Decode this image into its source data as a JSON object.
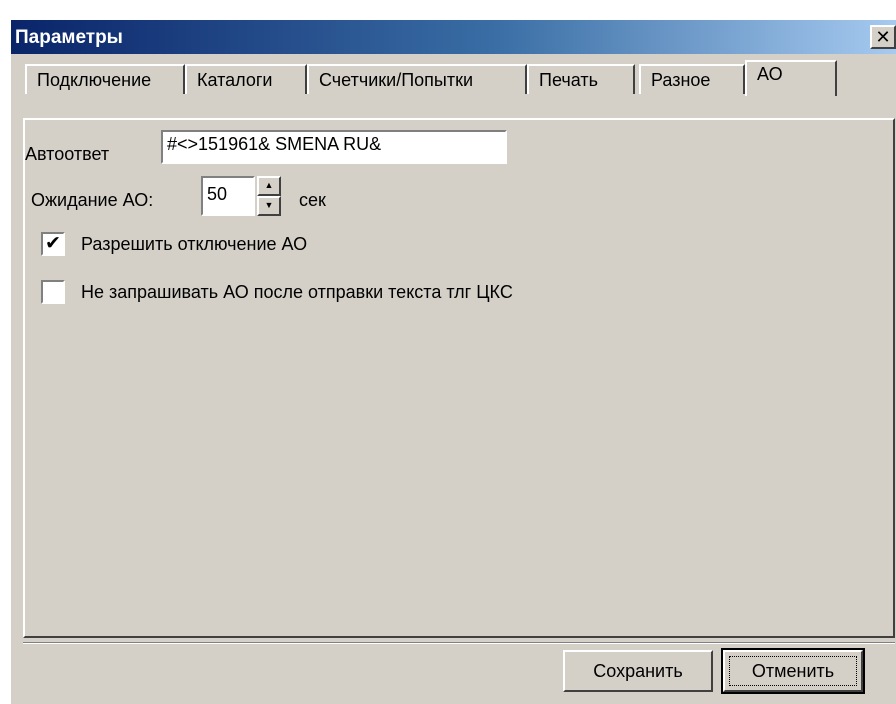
{
  "window": {
    "title": "Параметры",
    "close_glyph": "✕",
    "close_icon": "close-icon"
  },
  "tabs": [
    {
      "label": "Подключение",
      "active": false
    },
    {
      "label": "Каталоги",
      "active": false
    },
    {
      "label": "Счетчики/Попытки",
      "active": false
    },
    {
      "label": "Печать",
      "active": false
    },
    {
      "label": "Разное",
      "active": false
    },
    {
      "label": "АО",
      "active": true
    }
  ],
  "form": {
    "autoreply_label": "Автоответ",
    "autoreply_value": "#<>151961& SMENA RU&",
    "wait_label": "Ожидание АО:",
    "wait_value": "50",
    "wait_unit": "сек",
    "spin_up_glyph": "▲",
    "spin_down_glyph": "▼",
    "allow_disable": {
      "label": "Разрешить отключение АО",
      "checked": true,
      "check_glyph": "✔"
    },
    "no_ask": {
      "label": "Не запрашивать АО после отправки текста тлг ЦКС",
      "checked": false,
      "check_glyph": ""
    }
  },
  "buttons": {
    "save": "Сохранить",
    "cancel": "Отменить"
  },
  "colors": {
    "window_bg": "#d4d0c8",
    "title_start": "#0a246a",
    "title_end": "#a6caf0"
  }
}
